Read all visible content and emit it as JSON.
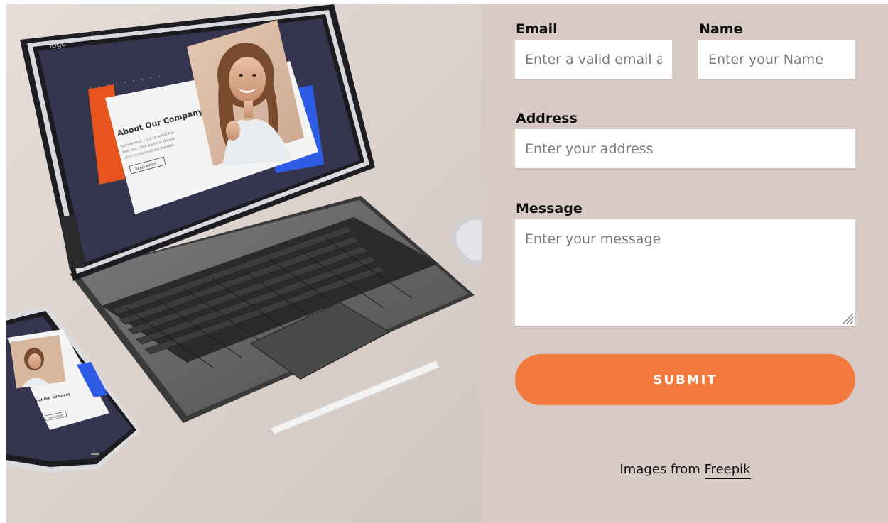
{
  "hero": {
    "tablet_logo_text": "logo",
    "tablet_card_heading": "About Our Company",
    "tablet_card_body": [
      "Sample text. Click to select the",
      "text box. Click again or double",
      "click to start editing the text."
    ],
    "tablet_card_button": "READ MORE",
    "phone_card_heading": "About Our Company",
    "phone_card_button": "LEARN MORE"
  },
  "form": {
    "email": {
      "label": "Email",
      "placeholder": "Enter a valid email address"
    },
    "name": {
      "label": "Name",
      "placeholder": "Enter your Name"
    },
    "address": {
      "label": "Address",
      "placeholder": "Enter your address"
    },
    "message": {
      "label": "Message",
      "placeholder": "Enter your message"
    },
    "submit_label": "SUBMIT"
  },
  "credit": {
    "prefix": "Images from ",
    "link_text": "Freepik"
  },
  "colors": {
    "page_background": "#d8cbc6",
    "accent_orange": "#f27a3e",
    "tablet_screen": "#35354f",
    "accent_blue": "#2f5ce6",
    "accent_red": "#e8541e"
  }
}
